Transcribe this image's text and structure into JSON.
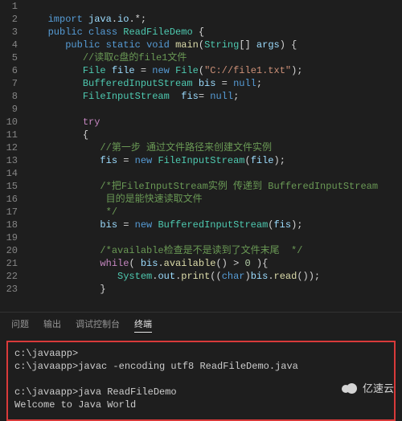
{
  "editor": {
    "first_line": 1,
    "lines": [
      {
        "indent": 0,
        "tokens": []
      },
      {
        "indent": 1,
        "tokens": [
          [
            "kw",
            "import"
          ],
          [
            "pn",
            " "
          ],
          [
            "var",
            "java"
          ],
          [
            "pn",
            "."
          ],
          [
            "var",
            "io"
          ],
          [
            "pn",
            ".*;"
          ]
        ]
      },
      {
        "indent": 1,
        "tokens": [
          [
            "kw",
            "public"
          ],
          [
            "pn",
            " "
          ],
          [
            "kw",
            "class"
          ],
          [
            "pn",
            " "
          ],
          [
            "type",
            "ReadFileDemo"
          ],
          [
            "pn",
            " {"
          ]
        ]
      },
      {
        "indent": 2,
        "tokens": [
          [
            "kw",
            "public"
          ],
          [
            "pn",
            " "
          ],
          [
            "kw",
            "static"
          ],
          [
            "pn",
            " "
          ],
          [
            "kw",
            "void"
          ],
          [
            "pn",
            " "
          ],
          [
            "fn",
            "main"
          ],
          [
            "pn",
            "("
          ],
          [
            "type",
            "String"
          ],
          [
            "pn",
            "[] "
          ],
          [
            "var",
            "args"
          ],
          [
            "pn",
            ") {"
          ]
        ]
      },
      {
        "indent": 3,
        "tokens": [
          [
            "cmt",
            "//读取c盘的file1文件"
          ]
        ]
      },
      {
        "indent": 3,
        "tokens": [
          [
            "type",
            "File"
          ],
          [
            "pn",
            " "
          ],
          [
            "var",
            "file"
          ],
          [
            "pn",
            " = "
          ],
          [
            "kw",
            "new"
          ],
          [
            "pn",
            " "
          ],
          [
            "type",
            "File"
          ],
          [
            "pn",
            "("
          ],
          [
            "str",
            "\"C://file1.txt\""
          ],
          [
            "pn",
            ");"
          ]
        ]
      },
      {
        "indent": 3,
        "tokens": [
          [
            "type",
            "BufferedInputStream"
          ],
          [
            "pn",
            " "
          ],
          [
            "var",
            "bis"
          ],
          [
            "pn",
            " = "
          ],
          [
            "kw",
            "null"
          ],
          [
            "pn",
            ";"
          ]
        ]
      },
      {
        "indent": 3,
        "tokens": [
          [
            "type",
            "FileInputStream"
          ],
          [
            "pn",
            "  "
          ],
          [
            "var",
            "fis"
          ],
          [
            "pn",
            "= "
          ],
          [
            "kw",
            "null"
          ],
          [
            "pn",
            ";"
          ]
        ]
      },
      {
        "indent": 0,
        "tokens": []
      },
      {
        "indent": 3,
        "tokens": [
          [
            "kw2",
            "try"
          ]
        ]
      },
      {
        "indent": 3,
        "tokens": [
          [
            "pn",
            "{"
          ]
        ]
      },
      {
        "indent": 4,
        "tokens": [
          [
            "cmt",
            "//第一步 通过文件路径来创建文件实例"
          ]
        ]
      },
      {
        "indent": 4,
        "tokens": [
          [
            "var",
            "fis"
          ],
          [
            "pn",
            " = "
          ],
          [
            "kw",
            "new"
          ],
          [
            "pn",
            " "
          ],
          [
            "type",
            "FileInputStream"
          ],
          [
            "pn",
            "("
          ],
          [
            "var",
            "file"
          ],
          [
            "pn",
            ");"
          ]
        ]
      },
      {
        "indent": 0,
        "tokens": []
      },
      {
        "indent": 4,
        "tokens": [
          [
            "cmt",
            "/*把FileInputStream实例 传递到 BufferedInputStream"
          ]
        ]
      },
      {
        "indent": 4,
        "tokens": [
          [
            "cmt",
            " 目的是能快速读取文件"
          ]
        ]
      },
      {
        "indent": 4,
        "tokens": [
          [
            "cmt",
            " */"
          ]
        ]
      },
      {
        "indent": 4,
        "tokens": [
          [
            "var",
            "bis"
          ],
          [
            "pn",
            " = "
          ],
          [
            "kw",
            "new"
          ],
          [
            "pn",
            " "
          ],
          [
            "type",
            "BufferedInputStream"
          ],
          [
            "pn",
            "("
          ],
          [
            "var",
            "fis"
          ],
          [
            "pn",
            ");"
          ]
        ]
      },
      {
        "indent": 0,
        "tokens": []
      },
      {
        "indent": 4,
        "tokens": [
          [
            "cmt",
            "/*available检查是不是读到了文件末尾  */"
          ]
        ]
      },
      {
        "indent": 4,
        "tokens": [
          [
            "kw2",
            "while"
          ],
          [
            "pn",
            "( "
          ],
          [
            "var",
            "bis"
          ],
          [
            "pn",
            "."
          ],
          [
            "fn",
            "available"
          ],
          [
            "pn",
            "() > "
          ],
          [
            "num",
            "0"
          ],
          [
            "pn",
            " ){"
          ]
        ]
      },
      {
        "indent": 5,
        "tokens": [
          [
            "type",
            "System"
          ],
          [
            "pn",
            "."
          ],
          [
            "var",
            "out"
          ],
          [
            "pn",
            "."
          ],
          [
            "fn",
            "print"
          ],
          [
            "pn",
            "(("
          ],
          [
            "kw",
            "char"
          ],
          [
            "pn",
            ")"
          ],
          [
            "var",
            "bis"
          ],
          [
            "pn",
            "."
          ],
          [
            "fn",
            "read"
          ],
          [
            "pn",
            "());"
          ]
        ]
      },
      {
        "indent": 4,
        "tokens": [
          [
            "pn",
            "}"
          ]
        ]
      }
    ]
  },
  "panel": {
    "tabs": {
      "problems": "问题",
      "output": "输出",
      "debug_console": "调试控制台",
      "terminal": "终端"
    },
    "active_tab": "terminal"
  },
  "terminal": {
    "lines": [
      "c:\\javaapp>",
      "c:\\javaapp>javac -encoding utf8 ReadFileDemo.java",
      "",
      "c:\\javaapp>java ReadFileDemo",
      "Welcome to Java World"
    ]
  },
  "watermark": {
    "text": "亿速云"
  }
}
